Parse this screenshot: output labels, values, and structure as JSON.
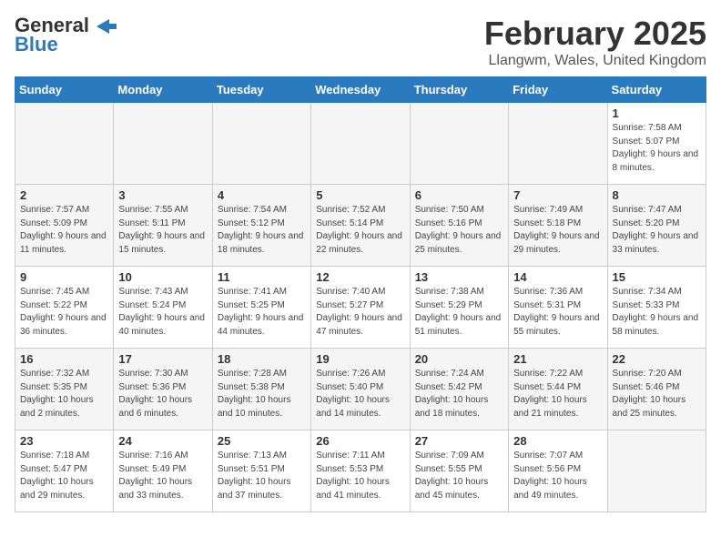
{
  "header": {
    "logo_line1": "General",
    "logo_line2": "Blue",
    "month_year": "February 2025",
    "location": "Llangwm, Wales, United Kingdom"
  },
  "days_of_week": [
    "Sunday",
    "Monday",
    "Tuesday",
    "Wednesday",
    "Thursday",
    "Friday",
    "Saturday"
  ],
  "weeks": [
    [
      {
        "day": "",
        "info": ""
      },
      {
        "day": "",
        "info": ""
      },
      {
        "day": "",
        "info": ""
      },
      {
        "day": "",
        "info": ""
      },
      {
        "day": "",
        "info": ""
      },
      {
        "day": "",
        "info": ""
      },
      {
        "day": "1",
        "info": "Sunrise: 7:58 AM\nSunset: 5:07 PM\nDaylight: 9 hours and 8 minutes."
      }
    ],
    [
      {
        "day": "2",
        "info": "Sunrise: 7:57 AM\nSunset: 5:09 PM\nDaylight: 9 hours and 11 minutes."
      },
      {
        "day": "3",
        "info": "Sunrise: 7:55 AM\nSunset: 5:11 PM\nDaylight: 9 hours and 15 minutes."
      },
      {
        "day": "4",
        "info": "Sunrise: 7:54 AM\nSunset: 5:12 PM\nDaylight: 9 hours and 18 minutes."
      },
      {
        "day": "5",
        "info": "Sunrise: 7:52 AM\nSunset: 5:14 PM\nDaylight: 9 hours and 22 minutes."
      },
      {
        "day": "6",
        "info": "Sunrise: 7:50 AM\nSunset: 5:16 PM\nDaylight: 9 hours and 25 minutes."
      },
      {
        "day": "7",
        "info": "Sunrise: 7:49 AM\nSunset: 5:18 PM\nDaylight: 9 hours and 29 minutes."
      },
      {
        "day": "8",
        "info": "Sunrise: 7:47 AM\nSunset: 5:20 PM\nDaylight: 9 hours and 33 minutes."
      }
    ],
    [
      {
        "day": "9",
        "info": "Sunrise: 7:45 AM\nSunset: 5:22 PM\nDaylight: 9 hours and 36 minutes."
      },
      {
        "day": "10",
        "info": "Sunrise: 7:43 AM\nSunset: 5:24 PM\nDaylight: 9 hours and 40 minutes."
      },
      {
        "day": "11",
        "info": "Sunrise: 7:41 AM\nSunset: 5:25 PM\nDaylight: 9 hours and 44 minutes."
      },
      {
        "day": "12",
        "info": "Sunrise: 7:40 AM\nSunset: 5:27 PM\nDaylight: 9 hours and 47 minutes."
      },
      {
        "day": "13",
        "info": "Sunrise: 7:38 AM\nSunset: 5:29 PM\nDaylight: 9 hours and 51 minutes."
      },
      {
        "day": "14",
        "info": "Sunrise: 7:36 AM\nSunset: 5:31 PM\nDaylight: 9 hours and 55 minutes."
      },
      {
        "day": "15",
        "info": "Sunrise: 7:34 AM\nSunset: 5:33 PM\nDaylight: 9 hours and 58 minutes."
      }
    ],
    [
      {
        "day": "16",
        "info": "Sunrise: 7:32 AM\nSunset: 5:35 PM\nDaylight: 10 hours and 2 minutes."
      },
      {
        "day": "17",
        "info": "Sunrise: 7:30 AM\nSunset: 5:36 PM\nDaylight: 10 hours and 6 minutes."
      },
      {
        "day": "18",
        "info": "Sunrise: 7:28 AM\nSunset: 5:38 PM\nDaylight: 10 hours and 10 minutes."
      },
      {
        "day": "19",
        "info": "Sunrise: 7:26 AM\nSunset: 5:40 PM\nDaylight: 10 hours and 14 minutes."
      },
      {
        "day": "20",
        "info": "Sunrise: 7:24 AM\nSunset: 5:42 PM\nDaylight: 10 hours and 18 minutes."
      },
      {
        "day": "21",
        "info": "Sunrise: 7:22 AM\nSunset: 5:44 PM\nDaylight: 10 hours and 21 minutes."
      },
      {
        "day": "22",
        "info": "Sunrise: 7:20 AM\nSunset: 5:46 PM\nDaylight: 10 hours and 25 minutes."
      }
    ],
    [
      {
        "day": "23",
        "info": "Sunrise: 7:18 AM\nSunset: 5:47 PM\nDaylight: 10 hours and 29 minutes."
      },
      {
        "day": "24",
        "info": "Sunrise: 7:16 AM\nSunset: 5:49 PM\nDaylight: 10 hours and 33 minutes."
      },
      {
        "day": "25",
        "info": "Sunrise: 7:13 AM\nSunset: 5:51 PM\nDaylight: 10 hours and 37 minutes."
      },
      {
        "day": "26",
        "info": "Sunrise: 7:11 AM\nSunset: 5:53 PM\nDaylight: 10 hours and 41 minutes."
      },
      {
        "day": "27",
        "info": "Sunrise: 7:09 AM\nSunset: 5:55 PM\nDaylight: 10 hours and 45 minutes."
      },
      {
        "day": "28",
        "info": "Sunrise: 7:07 AM\nSunset: 5:56 PM\nDaylight: 10 hours and 49 minutes."
      },
      {
        "day": "",
        "info": ""
      }
    ]
  ]
}
